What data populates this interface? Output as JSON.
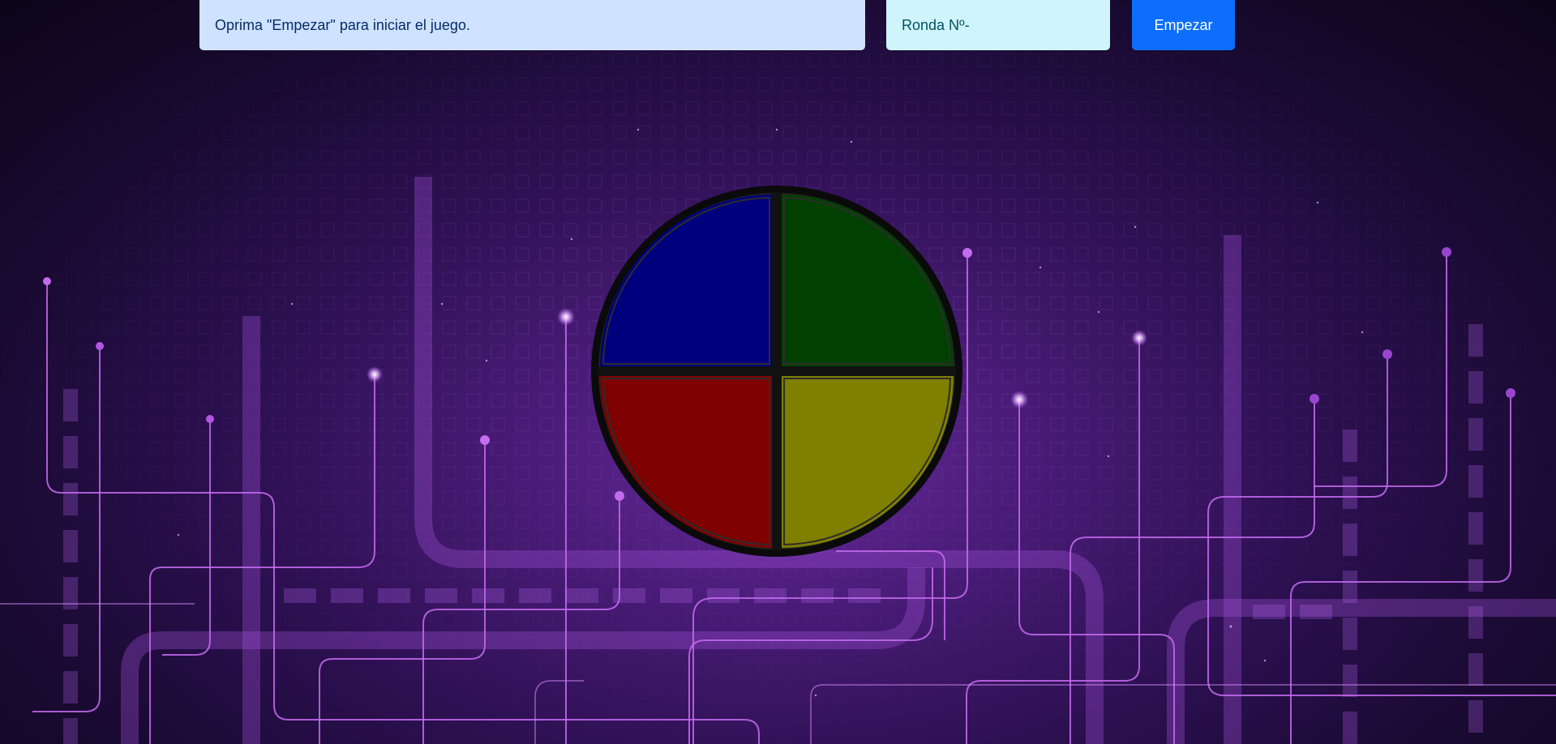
{
  "header": {
    "message": "Oprima \"Empezar\" para iniciar el juego.",
    "round_label": "Ronda Nº-",
    "start_button_label": "Empezar"
  },
  "game": {
    "buttons": [
      {
        "id": "blue",
        "color": "#00007f"
      },
      {
        "id": "green",
        "color": "#004000"
      },
      {
        "id": "red",
        "color": "#7f0000"
      },
      {
        "id": "yellow",
        "color": "#7f7f00"
      }
    ],
    "border_color": "#0a0a0a"
  },
  "theme": {
    "message_bg": "#cfe2ff",
    "round_bg": "#cff4fc",
    "button_bg": "#0d6efd",
    "background_accent": "#a24ee0"
  }
}
